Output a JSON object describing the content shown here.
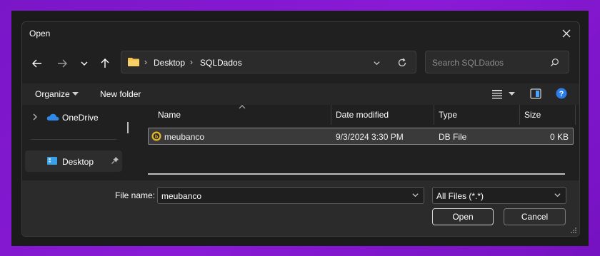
{
  "dialog": {
    "title": "Open"
  },
  "nav": {
    "back": "back-arrow-icon",
    "forward": "forward-arrow-icon",
    "recent": "chevron-down-icon",
    "up": "up-arrow-icon"
  },
  "address": {
    "crumbs": [
      "Desktop",
      "SQLDados"
    ]
  },
  "search": {
    "placeholder": "Search SQLDados"
  },
  "commandbar": {
    "organize": "Organize",
    "new_folder": "New folder"
  },
  "sidebar": {
    "items": [
      {
        "label": "OneDrive"
      },
      {
        "label": "Desktop"
      }
    ]
  },
  "list": {
    "columns": [
      "Name",
      "Date modified",
      "Type",
      "Size"
    ],
    "rows": [
      {
        "name": "meubanco",
        "date": "9/3/2024 3:30 PM",
        "type": "DB File",
        "size": "0 KB"
      }
    ]
  },
  "footer": {
    "filename_label": "File name:",
    "filename_value": "meubanco",
    "filter_value": "All Files (*.*)",
    "open_label": "Open",
    "cancel_label": "Cancel"
  },
  "colors": {
    "background": "#8a1ad6",
    "dialog": "#202020",
    "accent": "#2b7de9",
    "folder": "#f3c14b"
  }
}
